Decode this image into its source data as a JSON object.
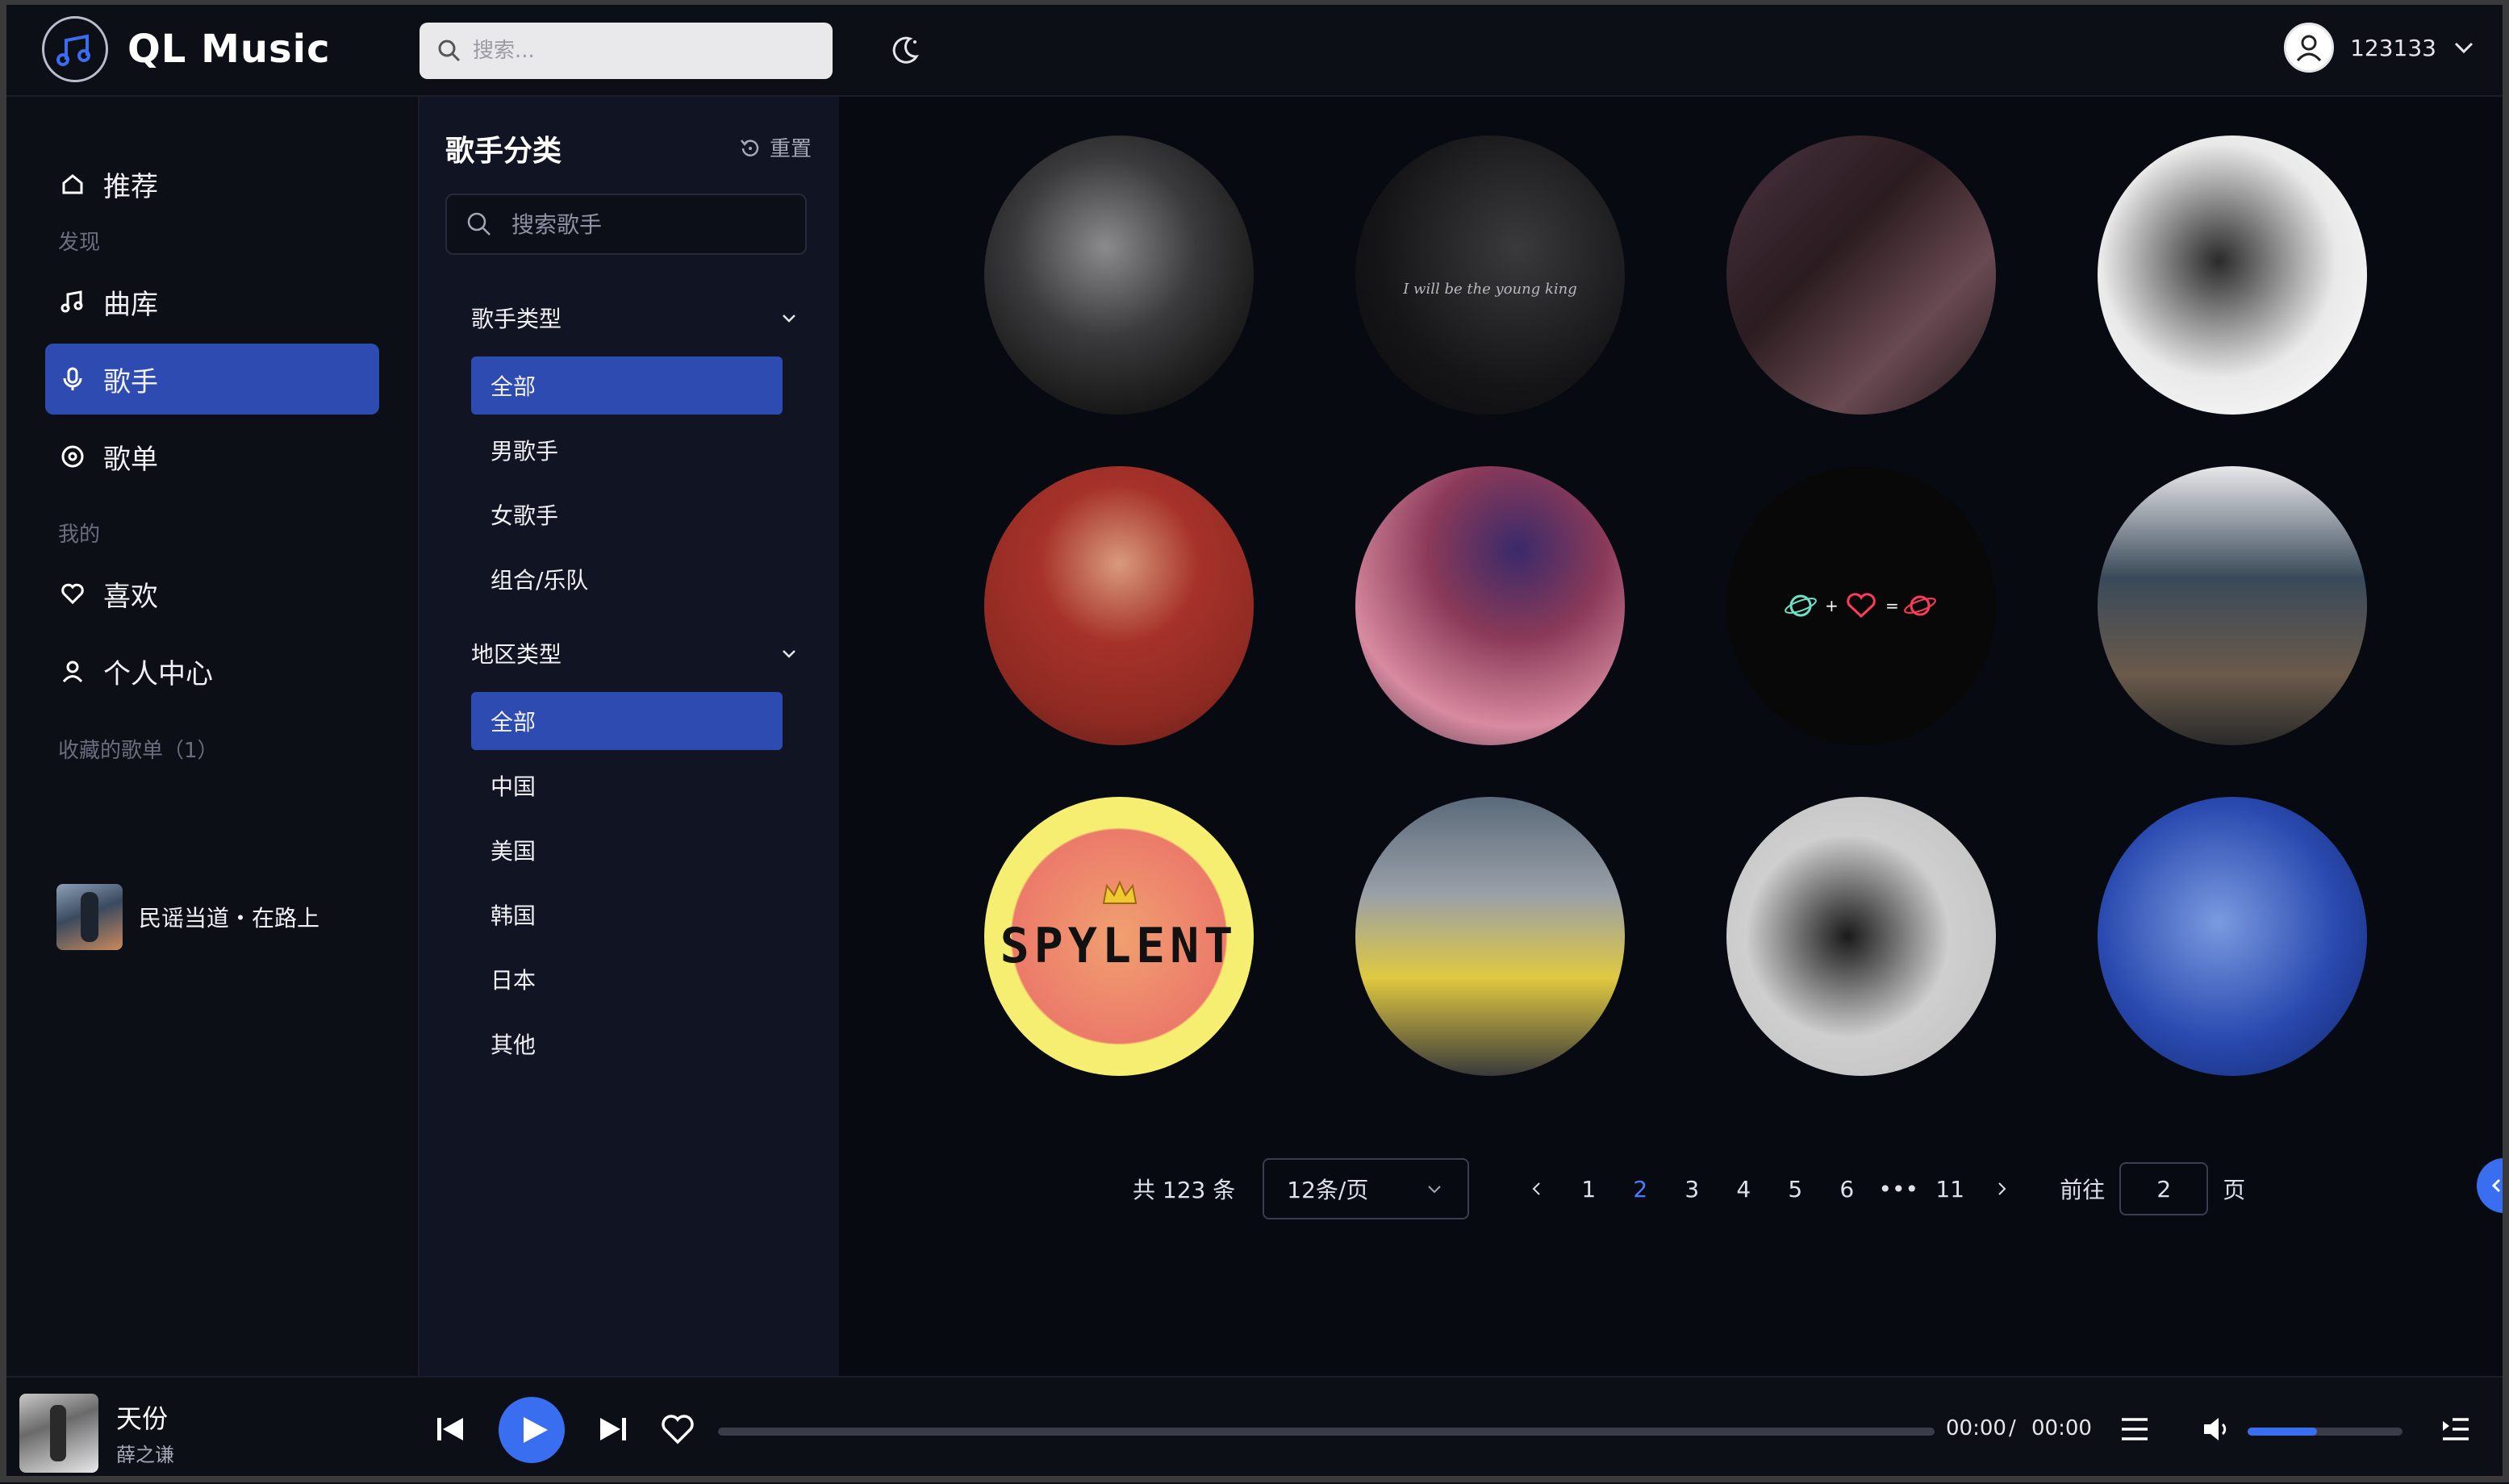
{
  "app": {
    "name": "QL Music"
  },
  "header": {
    "search_placeholder": "搜索...",
    "username": "123133"
  },
  "sidebar": {
    "recommend": "推荐",
    "discover_label": "发现",
    "library": "曲库",
    "singers": "歌手",
    "playlists": "歌单",
    "mine_label": "我的",
    "likes": "喜欢",
    "profile": "个人中心",
    "favorites_label": "收藏的歌单（1）",
    "favorite_playlist": "民谣当道・在路上"
  },
  "filter": {
    "title": "歌手分类",
    "reset": "重置",
    "search_placeholder": "搜索歌手",
    "type_group": {
      "label": "歌手类型",
      "options": [
        "全部",
        "男歌手",
        "女歌手",
        "组合/乐队"
      ],
      "selected": "全部"
    },
    "region_group": {
      "label": "地区类型",
      "options": [
        "全部",
        "中国",
        "美国",
        "韩国",
        "日本",
        "其他"
      ],
      "selected": "全部"
    }
  },
  "artists": {
    "a2_text": "I will be the young king",
    "a9_text": "SPYLENT"
  },
  "pagination": {
    "total": "共 123 条",
    "page_size": "12条/页",
    "pages": [
      "1",
      "2",
      "3",
      "4",
      "5",
      "6",
      "•••",
      "11"
    ],
    "current": "2",
    "goto_label": "前往",
    "goto_value": "2",
    "page_unit": "页"
  },
  "player": {
    "song": "天份",
    "artist": "薛之谦",
    "elapsed": "00:00",
    "separator": "/",
    "duration": "00:00",
    "volume": 0.45
  },
  "colors": {
    "accent": "#3a6ef0",
    "active_bg": "#2d4bb0",
    "background": "#080a12"
  }
}
